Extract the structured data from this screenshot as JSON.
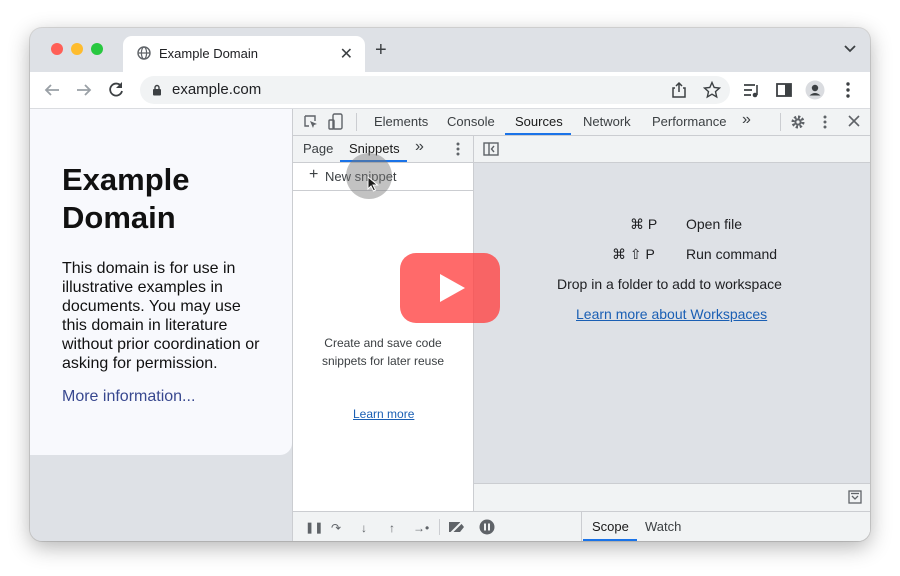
{
  "browser": {
    "tab_title": "Example Domain",
    "url": "example.com"
  },
  "page": {
    "heading": "Example Domain",
    "body": "This domain is for use in illustrative examples in documents. You may use this domain in literature without prior coordination or asking for permission.",
    "link": "More information..."
  },
  "devtools": {
    "tabs": [
      "Elements",
      "Console",
      "Sources",
      "Network",
      "Performance"
    ],
    "active_tab": "Sources",
    "more_tabs": "»",
    "navigator_tabs": [
      "Page",
      "Snippets"
    ],
    "navigator_active": "Snippets",
    "new_snippet": "New snippet",
    "empty_text": "Create and save code snippets for later reuse",
    "learn_more": "Learn more",
    "shortcuts": [
      {
        "keys": "⌘ P",
        "label": "Open file"
      },
      {
        "keys": "⌘ ⇧ P",
        "label": "Run command"
      }
    ],
    "drop_text": "Drop in a folder to add to workspace",
    "workspaces_link": "Learn more about Workspaces",
    "debug_tabs": [
      "Scope",
      "Watch"
    ],
    "debug_active": "Scope"
  },
  "colors": {
    "accent": "#1a73e8",
    "play_button": "#ff4040"
  }
}
